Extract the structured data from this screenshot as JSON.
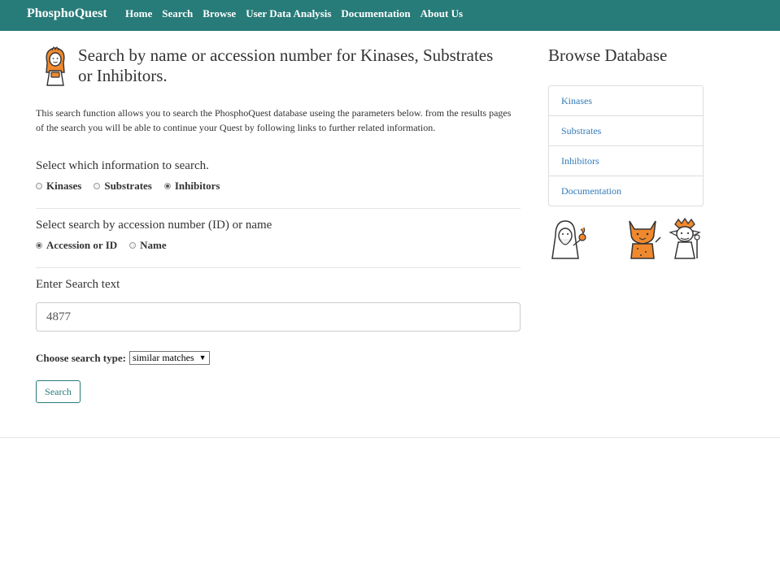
{
  "navbar": {
    "brand": "PhosphoQuest",
    "links": [
      "Home",
      "Search",
      "Browse",
      "User Data Analysis",
      "Documentation",
      "About Us"
    ],
    "bg_color": "#277b78"
  },
  "main": {
    "title": "Search by name or accession number for Kinases, Substrates or Inhibitors.",
    "intro": "This search function allows you to search the PhosphoQuest database useing the parameters below. from the results pages of the search you will be able to continue your Quest by following links to further related information.",
    "info_section": {
      "label": "Select which information to search.",
      "options": [
        "Kinases",
        "Substrates",
        "Inhibitors"
      ],
      "selected": "Inhibitors"
    },
    "id_section": {
      "label": "Select search by accession number (ID) or name",
      "options": [
        "Accession or ID",
        "Name"
      ],
      "selected": "Accession or ID"
    },
    "search_text": {
      "label": "Enter Search text",
      "value": "4877"
    },
    "search_type": {
      "label": "Choose search type:",
      "selected": "similar matches"
    },
    "search_button": "Search"
  },
  "sidebar": {
    "title": "Browse Database",
    "links": [
      "Kinases",
      "Substrates",
      "Inhibitors",
      "Documentation"
    ]
  },
  "icons": {
    "hero": "princess-mascot-icon",
    "mascots": [
      "wizard-mascot-icon",
      "fox-warrior-mascot-icon",
      "goblin-mage-mascot-icon"
    ]
  },
  "colors": {
    "accent": "#277b78",
    "link": "#337ab7",
    "mascot_orange": "#f0892e"
  }
}
